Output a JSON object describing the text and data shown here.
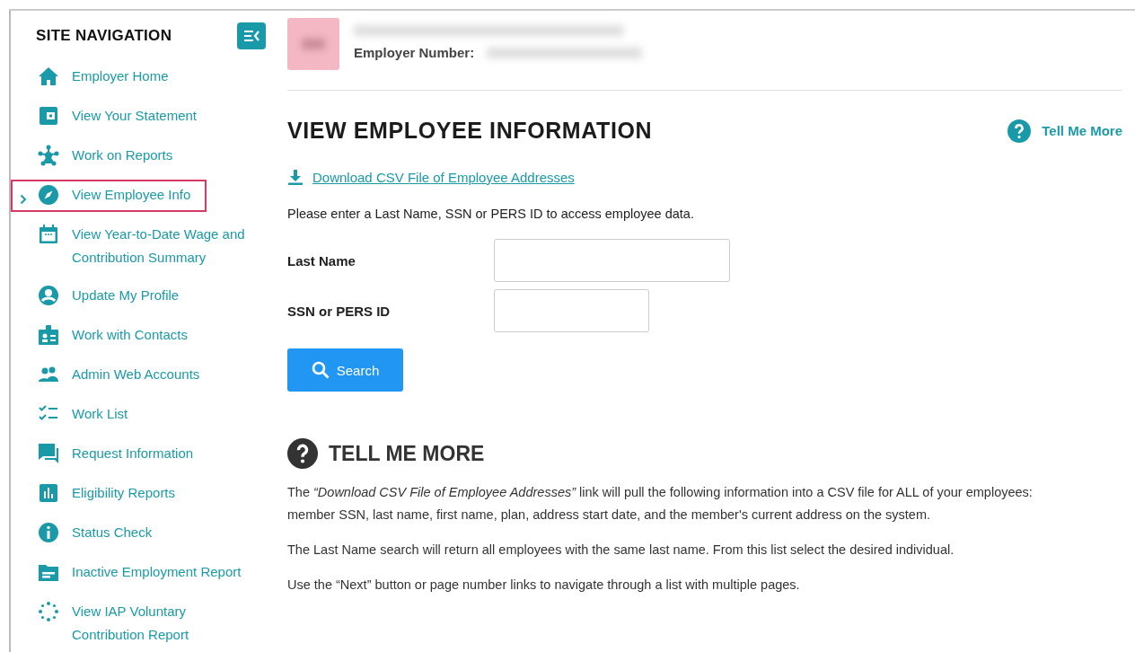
{
  "sidebar": {
    "title": "SITE NAVIGATION",
    "items": [
      {
        "label": "Employer Home",
        "selected": false
      },
      {
        "label": "View Your Statement",
        "selected": false
      },
      {
        "label": "Work on Reports",
        "selected": false
      },
      {
        "label": "View Employee Info",
        "selected": true
      },
      {
        "label": "View Year-to-Date Wage and Contribution Summary",
        "selected": false
      },
      {
        "label": "Update My Profile",
        "selected": false
      },
      {
        "label": "Work with Contacts",
        "selected": false
      },
      {
        "label": "Admin Web Accounts",
        "selected": false
      },
      {
        "label": "Work List",
        "selected": false
      },
      {
        "label": "Request Information",
        "selected": false
      },
      {
        "label": "Eligibility Reports",
        "selected": false
      },
      {
        "label": "Status Check",
        "selected": false
      },
      {
        "label": "Inactive Employment Report",
        "selected": false
      },
      {
        "label": "View IAP Voluntary Contribution Report",
        "selected": false
      }
    ]
  },
  "header": {
    "employer_number_label": "Employer Number:"
  },
  "page": {
    "title": "VIEW EMPLOYEE INFORMATION",
    "help_link": "Tell Me More",
    "download_link": "Download CSV File of Employee Addresses",
    "instructions": "Please enter a Last Name, SSN or PERS ID to access employee data.",
    "fields": [
      {
        "label": "Last Name"
      },
      {
        "label": "SSN or PERS ID"
      }
    ],
    "search_button": "Search"
  },
  "help": {
    "title": "TELL ME MORE",
    "paragraphs": [
      "The *“Download CSV File of Employee Addresses”* link will pull the following information into a CSV file for ALL of your employees: member SSN, last name, first name, plan, address start date, and the member's current address on the system.",
      "The Last Name search will return all employees with the same last name. From this list select the desired individual.",
      "Use the “Next” button or page number links to navigate through a list with multiple pages."
    ]
  }
}
